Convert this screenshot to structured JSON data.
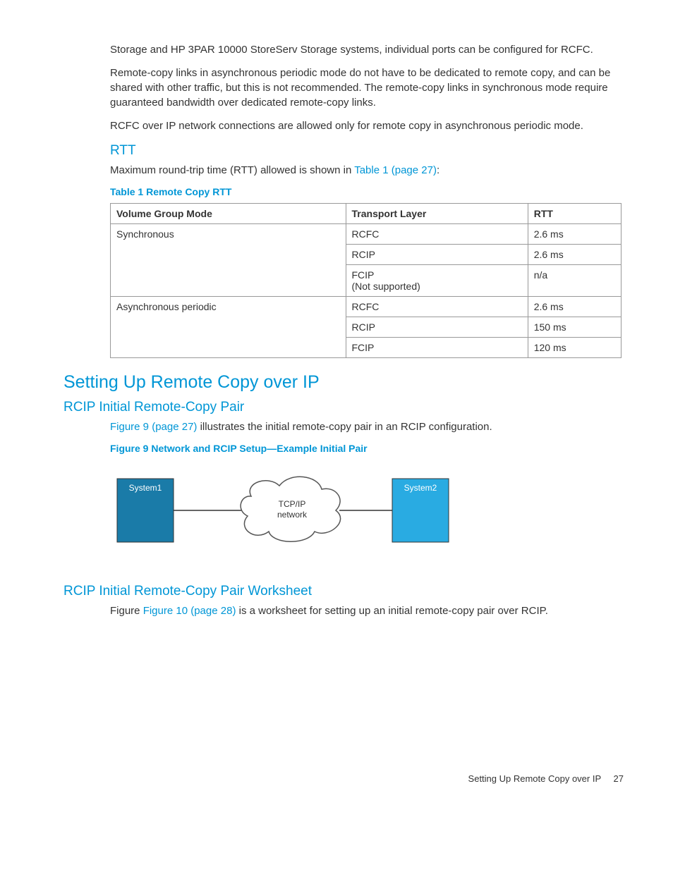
{
  "intro": {
    "p1": "Storage and HP 3PAR 10000 StoreServ Storage systems, individual ports can be configured for RCFC.",
    "p2": "Remote-copy links in asynchronous periodic mode do not have to be dedicated to remote copy, and can be shared with other traffic, but this is not recommended. The remote-copy links in synchronous mode require guaranteed bandwidth over dedicated remote-copy links.",
    "p3": "RCFC over IP network connections are allowed only for remote copy in asynchronous periodic mode."
  },
  "rtt": {
    "heading": "RTT",
    "lead_pre": "Maximum round-trip time (RTT) allowed is shown in ",
    "lead_link": "Table 1 (page 27)",
    "lead_post": ":",
    "table_caption": "Table 1 Remote Copy RTT",
    "columns": [
      "Volume Group Mode",
      "Transport Layer",
      "RTT"
    ],
    "rows": [
      {
        "mode": "Synchronous",
        "transport": "RCFC",
        "rtt": "2.6 ms"
      },
      {
        "mode": "",
        "transport": "RCIP",
        "rtt": "2.6 ms"
      },
      {
        "mode": "",
        "transport": "FCIP",
        "transport2": "(Not supported)",
        "rtt": "n/a"
      },
      {
        "mode": "Asynchronous periodic",
        "transport": "RCFC",
        "rtt": "2.6 ms"
      },
      {
        "mode": "",
        "transport": "RCIP",
        "rtt": "150 ms"
      },
      {
        "mode": "",
        "transport": "FCIP",
        "rtt": "120 ms"
      }
    ]
  },
  "setup": {
    "h1": "Setting Up Remote Copy over IP",
    "h2a": "RCIP Initial Remote-Copy Pair",
    "p1_link": "Figure 9 (page 27)",
    "p1_rest": " illustrates the initial remote-copy pair in an RCIP configuration.",
    "fig_caption": "Figure 9 Network and RCIP Setup—Example Initial Pair",
    "fig": {
      "sys1": "System1",
      "net": "TCP/IP",
      "net2": "network",
      "sys2": "System2"
    },
    "h2b": "RCIP Initial Remote-Copy Pair Worksheet",
    "p2_pre": "Figure ",
    "p2_link": "Figure 10 (page 28)",
    "p2_post": " is a worksheet for setting up an initial remote-copy pair over RCIP."
  },
  "footer": {
    "text": "Setting Up Remote Copy over IP",
    "page": "27"
  }
}
